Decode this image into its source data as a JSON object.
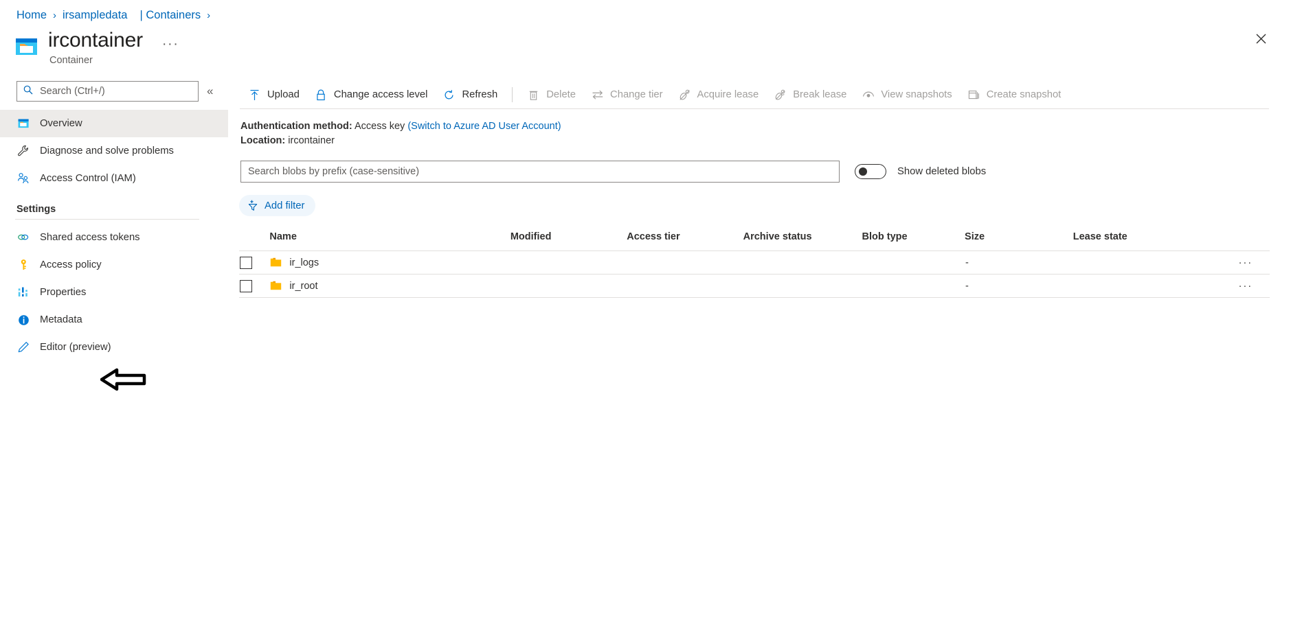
{
  "breadcrumb": {
    "items": [
      {
        "label": "Home",
        "link": true
      },
      {
        "label": "irsampledata",
        "link": true
      },
      {
        "label": "| Containers",
        "link": true
      }
    ],
    "separator": "›"
  },
  "header": {
    "title": "ircontainer",
    "subtitle": "Container",
    "icon": "container-icon",
    "ellipsis_label": "···",
    "close_label": "✕"
  },
  "sidebar": {
    "search": {
      "placeholder": "Search (Ctrl+/)",
      "value": "",
      "icon": "search-icon"
    },
    "collapse_label": "«",
    "items": [
      {
        "label": "Overview",
        "icon": "overview-icon",
        "selected": true
      },
      {
        "label": "Diagnose and solve problems",
        "icon": "wrench-icon",
        "selected": false
      },
      {
        "label": "Access Control (IAM)",
        "icon": "people-icon",
        "selected": false
      }
    ],
    "settings_group": {
      "title": "Settings",
      "items": [
        {
          "label": "Shared access tokens",
          "icon": "link-icon"
        },
        {
          "label": "Access policy",
          "icon": "key-icon"
        },
        {
          "label": "Properties",
          "icon": "properties-icon"
        },
        {
          "label": "Metadata",
          "icon": "info-icon"
        },
        {
          "label": "Editor (preview)",
          "icon": "pencil-icon"
        }
      ]
    }
  },
  "toolbar": {
    "commands": [
      {
        "label": "Upload",
        "icon": "upload-icon",
        "disabled": false
      },
      {
        "label": "Change access level",
        "icon": "lock-icon",
        "disabled": false
      },
      {
        "label": "Refresh",
        "icon": "refresh-icon",
        "disabled": false
      },
      {
        "separator": true
      },
      {
        "label": "Delete",
        "icon": "trash-icon",
        "disabled": true
      },
      {
        "label": "Change tier",
        "icon": "swap-icon",
        "disabled": true
      },
      {
        "label": "Acquire lease",
        "icon": "lease-icon",
        "disabled": true
      },
      {
        "label": "Break lease",
        "icon": "break-lease-icon",
        "disabled": true
      },
      {
        "label": "View snapshots",
        "icon": "snapshot-view-icon",
        "disabled": true
      },
      {
        "label": "Create snapshot",
        "icon": "snapshot-create-icon",
        "disabled": true
      }
    ]
  },
  "auth": {
    "method_label": "Authentication method:",
    "method_value": "Access key",
    "switch_link": "(Switch to Azure AD User Account)",
    "location_label": "Location:",
    "location_value": "ircontainer"
  },
  "filters": {
    "search_placeholder": "Search blobs by prefix (case-sensitive)",
    "search_value": "",
    "toggle_label": "Show deleted blobs",
    "toggle_on": false,
    "add_filter_label": "Add filter",
    "add_filter_icon": "add-filter-icon"
  },
  "table": {
    "columns": [
      "Name",
      "Modified",
      "Access tier",
      "Archive status",
      "Blob type",
      "Size",
      "Lease state"
    ],
    "rows": [
      {
        "name": "ir_logs",
        "icon": "folder-icon",
        "modified": "",
        "access_tier": "",
        "archive_status": "",
        "blob_type": "",
        "size": "-",
        "lease_state": "",
        "more_label": "···"
      },
      {
        "name": "ir_root",
        "icon": "folder-icon",
        "modified": "",
        "access_tier": "",
        "archive_status": "",
        "blob_type": "",
        "size": "-",
        "lease_state": "",
        "more_label": "···"
      }
    ]
  },
  "colors": {
    "accent": "#0067b8",
    "selected_row": "#edebe9",
    "folder": "#ffb900",
    "pill_bg": "#eff6fc"
  }
}
